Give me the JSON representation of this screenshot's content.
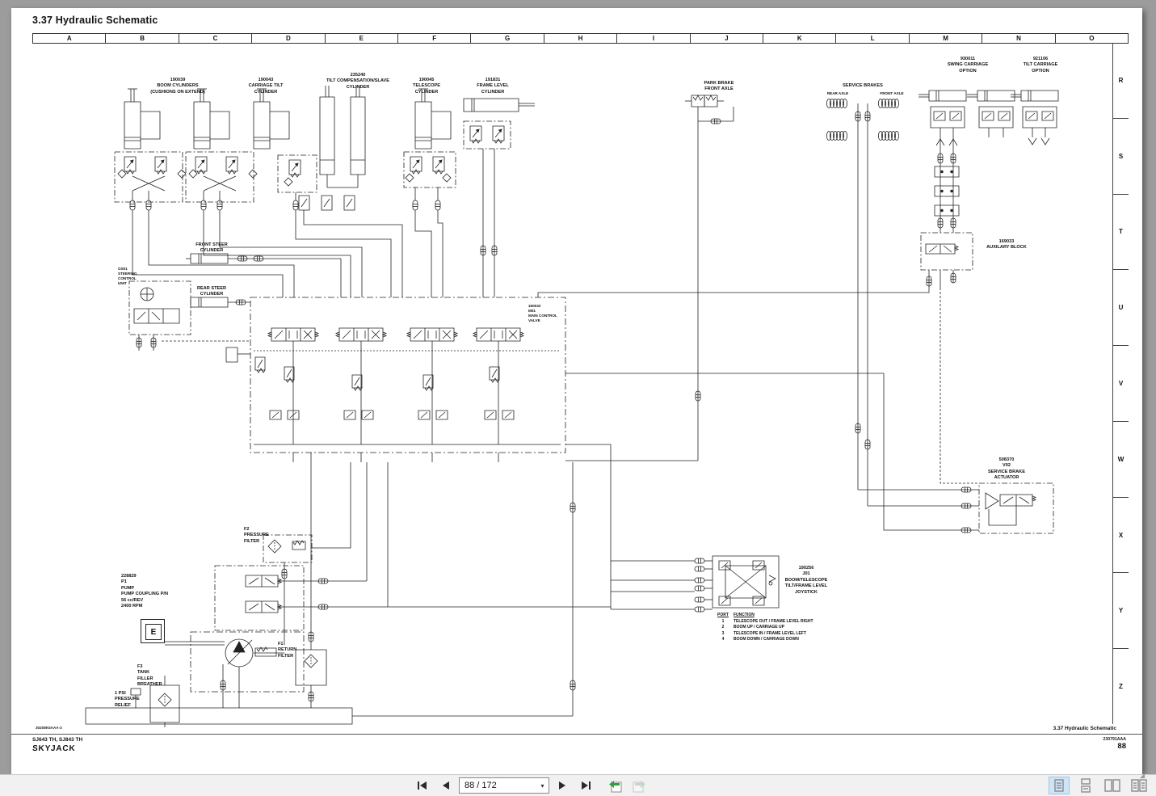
{
  "title": "3.37 Hydraulic Schematic",
  "grid": {
    "columns": [
      "A",
      "B",
      "C",
      "D",
      "E",
      "F",
      "G",
      "H",
      "I",
      "J",
      "K",
      "L",
      "M",
      "N",
      "O"
    ],
    "rows": [
      "R",
      "S",
      "T",
      "U",
      "V",
      "W",
      "X",
      "Y",
      "Z"
    ]
  },
  "labels": {
    "boom_cylinders": "190039\nBOOM CYLINDERS\n(CUSHIONS ON EXTEND)",
    "carriage_tilt": "190043\nCARRIAGE TILT\nCYLINDER",
    "tilt_comp": "235240\nTILT COMPENSATION/SLAVE\nCYLINDER",
    "telescope": "190045\nTELESCOPE\nCYLINDER",
    "frame_level": "191831\nFRAME LEVEL\nCYLINDER",
    "park_brake": "PARK BRAKE\nFRONT AXLE",
    "service_brakes": "SERVICE BRAKES",
    "rear_axle": "REAR AXLE",
    "front_axle": "FRONT AXLE",
    "swing_carriage": "930011\nSWING CARRIAGE\nOPTION",
    "tilt_carriage": "921106\nTILT CARRIAGE\nOPTION",
    "aux_block": "169033\nAUXILARY BLOCK",
    "front_steer": "FRONT STEER\nCYLINDER",
    "rear_steer": "REAR STEER\nCYLINDER",
    "steering_unit": "OS01\nSTEERING\nCONTROL\nUNIT",
    "main_valve": "160032\nM01\nMAIN CONTROL\nVALVE",
    "brake_actuator": "508370\nV02\nSERVICE BRAKE\nACTUATOR",
    "joystick": "190256\nJ01\nBOOM/TELESCOPE\nTILT/FRAME LEVEL\nJOYSTICK",
    "pressure_filter": "F2\nPRESSURE\nFILTER",
    "pump": "228829\nP1\nPUMP\nPUMP COUPLING P/N\n56 cc/REV\n2400 RPM",
    "engine": "E",
    "tank_breather": "F3\nTANK\nFILLER\nBREATHER",
    "psi_relief": "1 PSI\nPRESSURE\nRELIEF",
    "return_filter": "F1\nRETURN\nFILTER"
  },
  "joystick_table": {
    "port_header": "PORT",
    "function_header": "FUNCTION",
    "rows": [
      {
        "port": "1",
        "function": "TELESCOPE OUT / FRAME LEVEL RIGHT"
      },
      {
        "port": "2",
        "function": "BOOM UP / CARRIAGE UP"
      },
      {
        "port": "3",
        "function": "TELESCOPE IN / FRAME LEVEL LEFT"
      },
      {
        "port": "4",
        "function": "BOOM DOWN / CARRIAGE DOWN"
      }
    ]
  },
  "footer": {
    "drawing_code": "30208K5AAA-3",
    "models": "SJ643 TH, SJ843 TH",
    "brand": "SKYJACK",
    "section": "3.37  Hydraulic Schematic",
    "doc_code": "230791AAA",
    "page_number": "88"
  },
  "toolbar": {
    "page_field": "88 / 172",
    "caret": "▾"
  },
  "colors": {
    "selected_view_bg": "#cfe4f7",
    "selected_view_border": "#98c7ec",
    "icon_gray": "#8a8a8a",
    "nav_green": "#2f9e44",
    "line_black": "#222222"
  }
}
